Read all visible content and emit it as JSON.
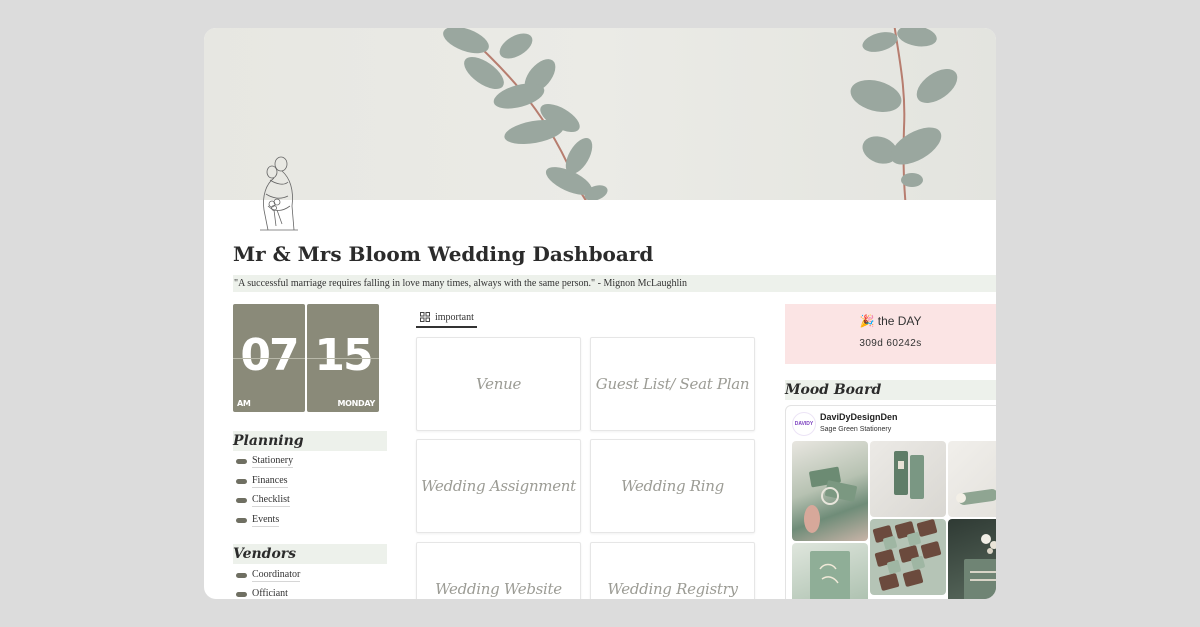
{
  "page": {
    "title": "Mr & Mrs Bloom Wedding Dashboard",
    "quote": "\"A successful marriage requires falling in love many times, always with the same person.\" - Mignon McLaughlin"
  },
  "clock": {
    "hour": "07",
    "minute": "15",
    "period": "AM",
    "weekday": "MONDAY"
  },
  "planning": {
    "title": "Planning",
    "items": [
      "Stationery",
      "Finances",
      "Checklist",
      "Events"
    ]
  },
  "vendors": {
    "title": "Vendors",
    "items": [
      "Coordinator",
      "Officiant"
    ]
  },
  "gallery": {
    "tab_label": "important",
    "tiles": [
      "Venue",
      "Guest List/ Seat Plan",
      "Wedding Assignment",
      "Wedding Ring",
      "Wedding Website",
      "Wedding Registry"
    ]
  },
  "countdown": {
    "emoji": "🎉",
    "label": "the DAY",
    "value": "309d 60242s"
  },
  "mood_board": {
    "title": "Mood Board",
    "pin": {
      "logo_text": "DAVIDY",
      "name": "DaviDyDesignDen",
      "subtitle": "Sage Green Stationery"
    }
  },
  "colors": {
    "sage": "#8a8a79",
    "highlight": "#edf1eb",
    "pink": "#fbe4e4"
  },
  "icons": {
    "gallery_tab": "grid-icon",
    "item_bullet": "pill-icon",
    "page_icon": "couple-sketch-icon"
  }
}
